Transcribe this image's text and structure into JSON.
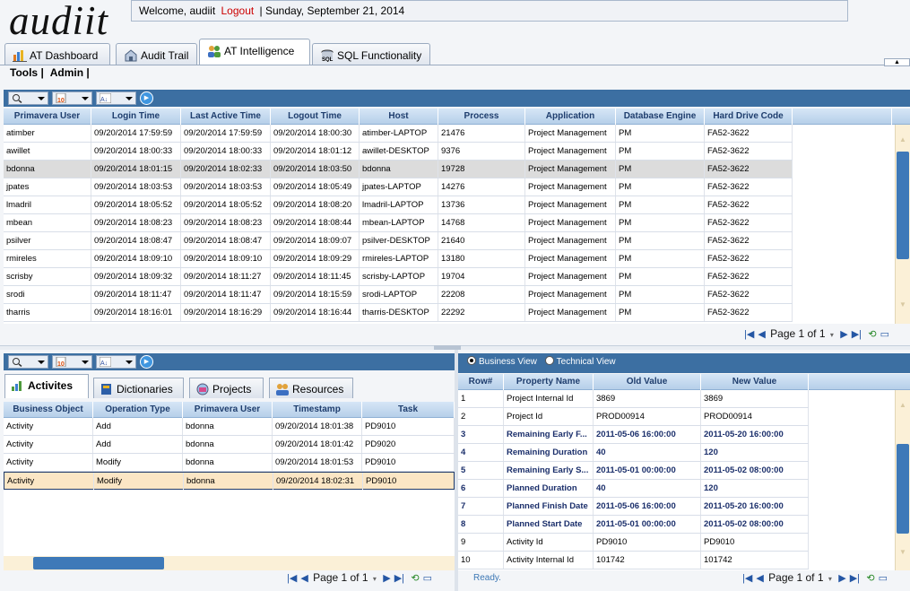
{
  "app": {
    "logo": "audiit"
  },
  "header": {
    "welcome": "Welcome, audiit",
    "logout": "Logout",
    "date": "| Sunday, September 21, 2014"
  },
  "tabs": [
    {
      "label": "AT Dashboard",
      "icon": "bar-chart-icon"
    },
    {
      "label": "Audit Trail",
      "icon": "building-icon"
    },
    {
      "label": "AT Intelligence",
      "icon": "people-icon",
      "active": true
    },
    {
      "label": "SQL Functionality",
      "icon": "sql-icon"
    }
  ],
  "menu": {
    "tools": "Tools |",
    "admin": "Admin |"
  },
  "sessions": {
    "columns": [
      "Primavera User",
      "Login Time",
      "Last Active Time",
      "Logout Time",
      "Host",
      "Process",
      "Application",
      "Database Engine",
      "Hard Drive Code"
    ],
    "rows": [
      [
        "atimber",
        "09/20/2014 17:59:59",
        "09/20/2014 17:59:59",
        "09/20/2014 18:00:30",
        "atimber-LAPTOP",
        "21476",
        "Project Management",
        "PM",
        "FA52-3622"
      ],
      [
        "awillet",
        "09/20/2014 18:00:33",
        "09/20/2014 18:00:33",
        "09/20/2014 18:01:12",
        "awillet-DESKTOP",
        "9376",
        "Project Management",
        "PM",
        "FA52-3622"
      ],
      [
        "bdonna",
        "09/20/2014 18:01:15",
        "09/20/2014 18:02:33",
        "09/20/2014 18:03:50",
        "bdonna",
        "19728",
        "Project Management",
        "PM",
        "FA52-3622"
      ],
      [
        "jpates",
        "09/20/2014 18:03:53",
        "09/20/2014 18:03:53",
        "09/20/2014 18:05:49",
        "jpates-LAPTOP",
        "14276",
        "Project Management",
        "PM",
        "FA52-3622"
      ],
      [
        "lmadril",
        "09/20/2014 18:05:52",
        "09/20/2014 18:05:52",
        "09/20/2014 18:08:20",
        "lmadril-LAPTOP",
        "13736",
        "Project Management",
        "PM",
        "FA52-3622"
      ],
      [
        "mbean",
        "09/20/2014 18:08:23",
        "09/20/2014 18:08:23",
        "09/20/2014 18:08:44",
        "mbean-LAPTOP",
        "14768",
        "Project Management",
        "PM",
        "FA52-3622"
      ],
      [
        "psilver",
        "09/20/2014 18:08:47",
        "09/20/2014 18:08:47",
        "09/20/2014 18:09:07",
        "psilver-DESKTOP",
        "21640",
        "Project Management",
        "PM",
        "FA52-3622"
      ],
      [
        "rmireles",
        "09/20/2014 18:09:10",
        "09/20/2014 18:09:10",
        "09/20/2014 18:09:29",
        "rmireles-LAPTOP",
        "13180",
        "Project Management",
        "PM",
        "FA52-3622"
      ],
      [
        "scrisby",
        "09/20/2014 18:09:32",
        "09/20/2014 18:11:27",
        "09/20/2014 18:11:45",
        "scrisby-LAPTOP",
        "19704",
        "Project Management",
        "PM",
        "FA52-3622"
      ],
      [
        "srodi",
        "09/20/2014 18:11:47",
        "09/20/2014 18:11:47",
        "09/20/2014 18:15:59",
        "srodi-LAPTOP",
        "22208",
        "Project Management",
        "PM",
        "FA52-3622"
      ],
      [
        "tharris",
        "09/20/2014 18:16:01",
        "09/20/2014 18:16:29",
        "09/20/2014 18:16:44",
        "tharris-DESKTOP",
        "22292",
        "Project Management",
        "PM",
        "FA52-3622"
      ]
    ],
    "selected_index": 2,
    "pager": {
      "label": "Page 1 of 1"
    }
  },
  "activities": {
    "tabs": [
      "Activites",
      "Dictionaries",
      "Projects",
      "Resources"
    ],
    "columns": [
      "Business Object",
      "Operation Type",
      "Primavera User",
      "Timestamp",
      "Task"
    ],
    "rows": [
      [
        "Activity",
        "Add",
        "bdonna",
        "09/20/2014 18:01:38",
        "PD9010"
      ],
      [
        "Activity",
        "Add",
        "bdonna",
        "09/20/2014 18:01:42",
        "PD9020"
      ],
      [
        "Activity",
        "Modify",
        "bdonna",
        "09/20/2014 18:01:53",
        "PD9010"
      ],
      [
        "Activity",
        "Modify",
        "bdonna",
        "09/20/2014 18:02:31",
        "PD9010"
      ]
    ],
    "selected_index": 3,
    "pager": {
      "label": "Page 1 of 1"
    }
  },
  "details": {
    "views": {
      "business": "Business View",
      "technical": "Technical View"
    },
    "columns": [
      "Row#",
      "Property Name",
      "Old Value",
      "New Value"
    ],
    "rows": [
      {
        "cells": [
          "1",
          "Project Internal Id",
          "3869",
          "3869"
        ],
        "bold": false
      },
      {
        "cells": [
          "2",
          "Project Id",
          "PROD00914",
          "PROD00914"
        ],
        "bold": false
      },
      {
        "cells": [
          "3",
          "Remaining Early F...",
          "2011-05-06 16:00:00",
          "2011-05-20 16:00:00"
        ],
        "bold": true
      },
      {
        "cells": [
          "4",
          "Remaining Duration",
          "40",
          "120"
        ],
        "bold": true
      },
      {
        "cells": [
          "5",
          "Remaining Early S...",
          "2011-05-01 00:00:00",
          "2011-05-02 08:00:00"
        ],
        "bold": true
      },
      {
        "cells": [
          "6",
          "Planned Duration",
          "40",
          "120"
        ],
        "bold": true
      },
      {
        "cells": [
          "7",
          "Planned Finish Date",
          "2011-05-06 16:00:00",
          "2011-05-20 16:00:00"
        ],
        "bold": true
      },
      {
        "cells": [
          "8",
          "Planned Start Date",
          "2011-05-01 00:00:00",
          "2011-05-02 08:00:00"
        ],
        "bold": true
      },
      {
        "cells": [
          "9",
          "Activity Id",
          "PD9010",
          "PD9010"
        ],
        "bold": false
      },
      {
        "cells": [
          "10",
          "Activity Internal Id",
          "101742",
          "101742"
        ],
        "bold": false
      }
    ],
    "pager": {
      "label": "Page 1 of 1"
    }
  },
  "status": {
    "text": "Ready."
  },
  "colors": {
    "toolbar": "#3c6fa2",
    "header_text": "#1e3d6d",
    "selected_row": "#dcdcdc",
    "highlight_row": "#fbe6c5",
    "scroll_thumb": "#3e79b8"
  }
}
